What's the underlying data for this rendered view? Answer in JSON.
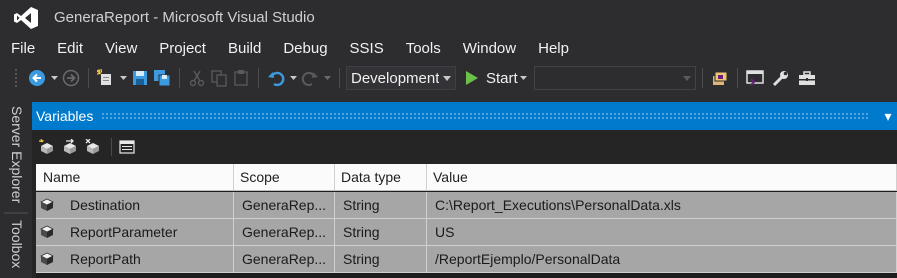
{
  "window": {
    "title": "GeneraReport - Microsoft Visual Studio",
    "app_logo": "visual-studio-logo"
  },
  "menu": {
    "items": [
      "File",
      "Edit",
      "View",
      "Project",
      "Build",
      "Debug",
      "SSIS",
      "Tools",
      "Window",
      "Help"
    ]
  },
  "toolbar": {
    "icons": [
      "back-icon",
      "forward-icon",
      "new-project-icon",
      "save-icon",
      "save-all-icon",
      "cut-icon",
      "copy-icon",
      "paste-icon",
      "undo-icon",
      "redo-icon",
      "solution-explorer-icon",
      "class-view-icon",
      "properties-icon",
      "toolbox-icon"
    ],
    "configuration": "Development",
    "start_label": "Start",
    "target_combo_value": ""
  },
  "side_tabs": {
    "server_explorer": "Server Explorer",
    "toolbox": "Toolbox"
  },
  "variables_window": {
    "title": "Variables",
    "pin_glyph": "▾",
    "toolbar_icons": [
      "add-variable-icon",
      "move-variable-icon",
      "delete-variable-icon",
      "grid-options-icon"
    ],
    "columns": [
      "Name",
      "Scope",
      "Data type",
      "Value"
    ],
    "rows": [
      {
        "name": "Destination",
        "scope": "GeneraRep...",
        "type": "String",
        "value": "C:\\Report_Executions\\PersonalData.xls"
      },
      {
        "name": "ReportParameter",
        "scope": "GeneraRep...",
        "type": "String",
        "value": "US"
      },
      {
        "name": "ReportPath",
        "scope": "GeneraRep...",
        "type": "String",
        "value": "/ReportEjemplo/PersonalData"
      }
    ]
  },
  "colors": {
    "accent": "#007acc",
    "background": "#2d2d30",
    "vs_purple": "#68217a",
    "start_green": "#6ac04a",
    "nav_blue": "#3b9bde"
  }
}
